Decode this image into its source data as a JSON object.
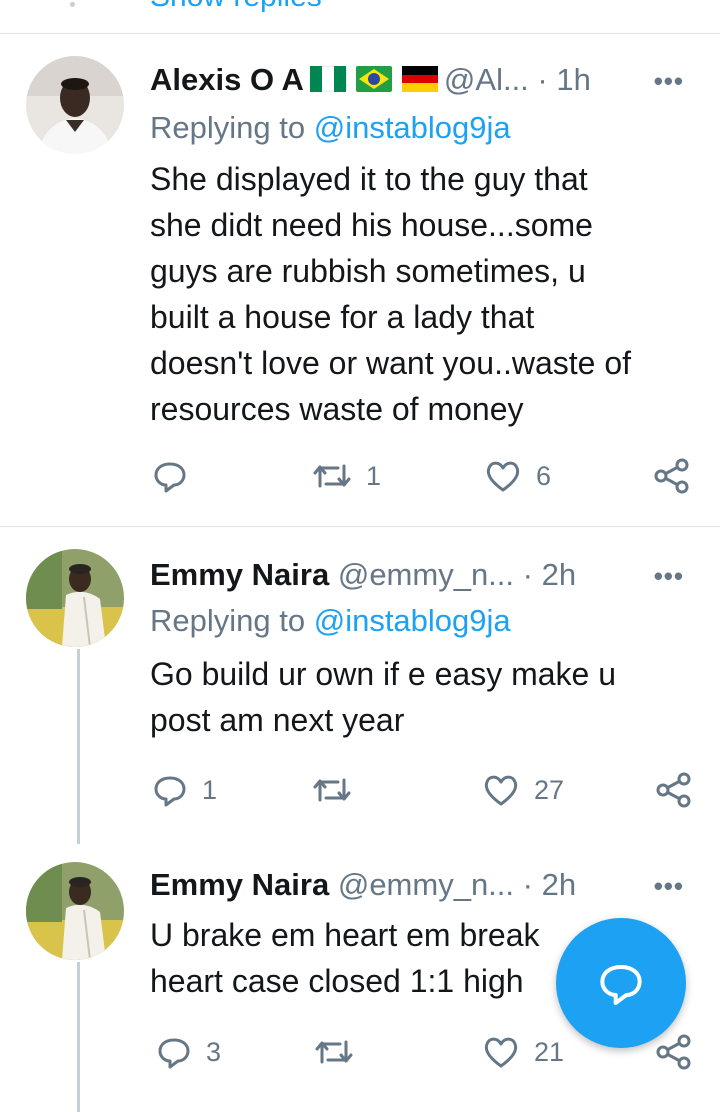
{
  "top": {
    "show_replies": "Show replies"
  },
  "tweets": [
    {
      "name": "Alexis O A",
      "flags": [
        "nigeria-flag",
        "brazil-flag",
        "germany-flag"
      ],
      "handle": "@Al...",
      "time": "· 1h",
      "replying_prefix": "Replying to",
      "replying_to": "@instablog9ja",
      "lines": [
        "She displayed it to the guy that",
        "she didt need his house...some",
        "guys are rubbish sometimes, u",
        "built a house for a lady that",
        "doesn't love or want you..waste of",
        "resources waste of money"
      ],
      "replies": "",
      "retweets": "1",
      "likes": "6"
    },
    {
      "name": "Emmy Naira",
      "handle": "@emmy_n...",
      "time": "· 2h",
      "replying_prefix": "Replying to",
      "replying_to": "@instablog9ja",
      "lines": [
        "Go build ur own if e easy make u",
        "post am next year"
      ],
      "replies": "1",
      "retweets": "",
      "likes": "27"
    },
    {
      "name": "Emmy Naira",
      "handle": "@emmy_n...",
      "time": "· 2h",
      "lines": [
        "U brake em heart em break",
        "heart case closed 1:1 high"
      ],
      "replies": "3",
      "retweets": "",
      "likes": "21"
    }
  ],
  "more_symbol": "•••",
  "fab": {
    "icon": "compose-reply-icon"
  },
  "colors": {
    "accent": "#1da1f2",
    "muted": "#657786",
    "text": "#14171a",
    "divider": "#dfe3e6"
  }
}
